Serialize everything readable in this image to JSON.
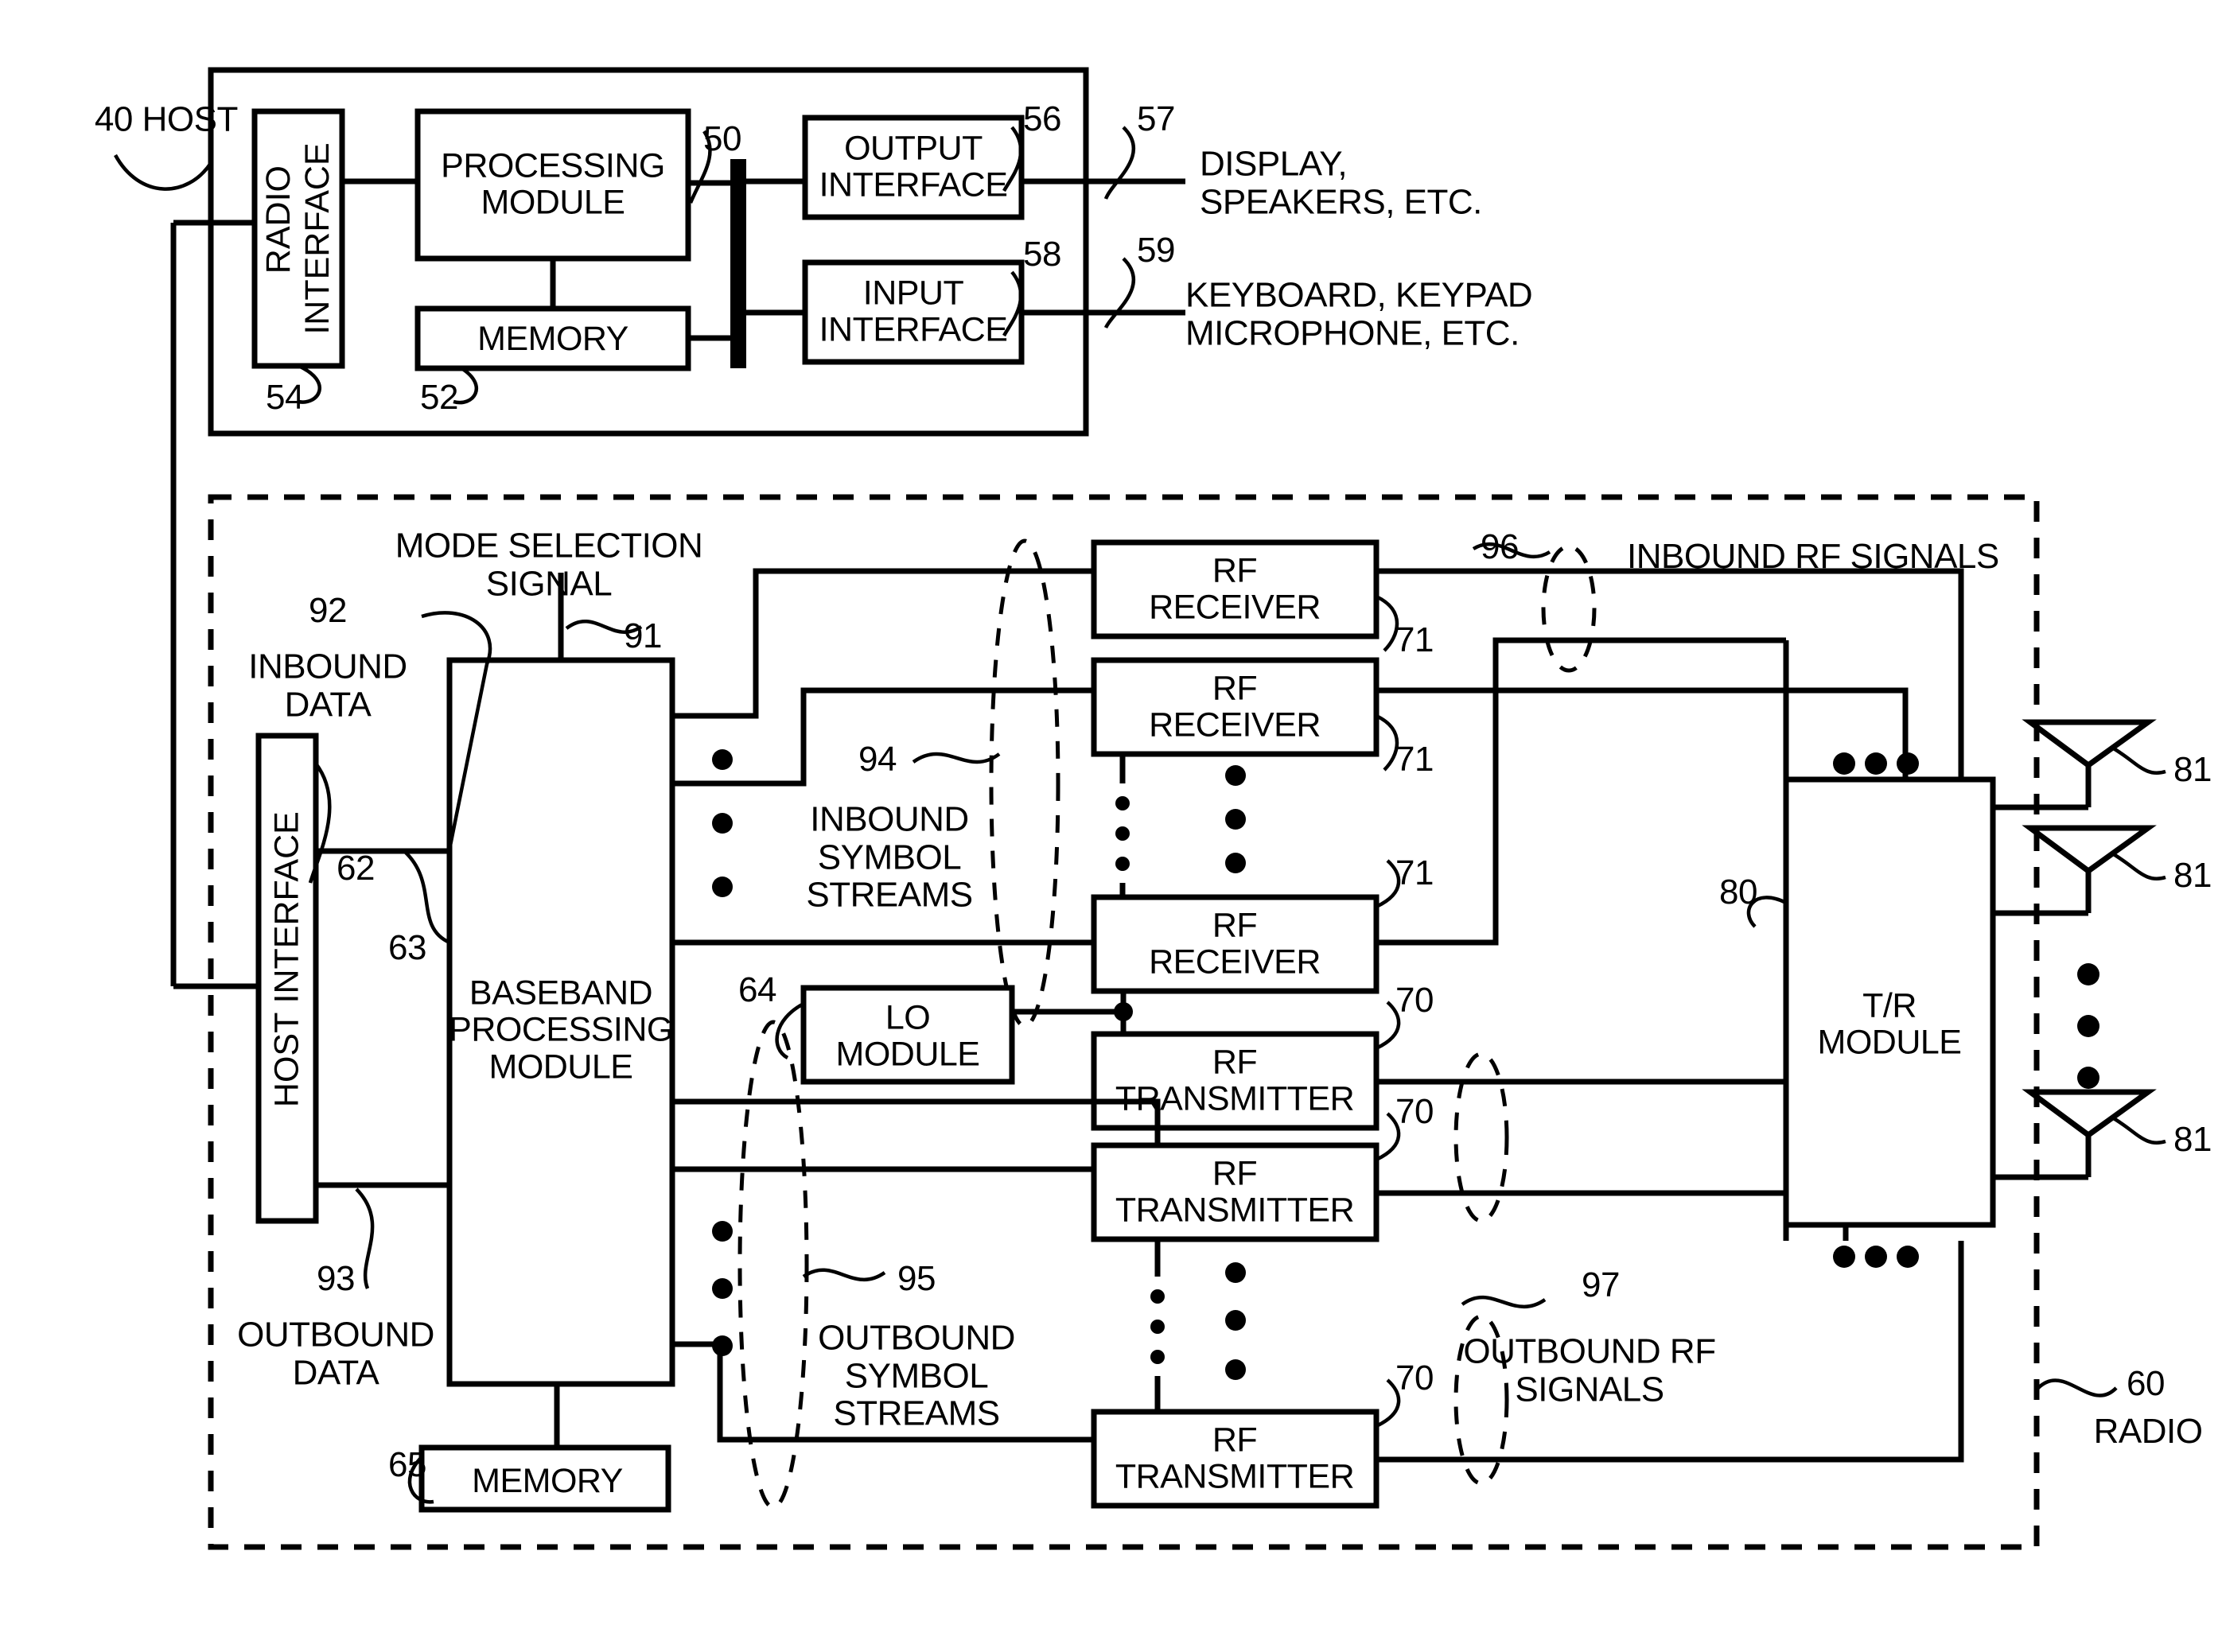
{
  "figure": {
    "type": "patent-block-diagram",
    "title": "Wireless communication device block diagram"
  },
  "host": {
    "ref": "40",
    "label": "HOST",
    "bus_ref": "50",
    "radio_interface": {
      "label": "RADIO\nINTERFACE",
      "ref": "54"
    },
    "processing_module": {
      "label": "PROCESSING\nMODULE",
      "ref": ""
    },
    "memory": {
      "label": "MEMORY",
      "ref": "52"
    },
    "output_interface": {
      "label": "OUTPUT\nINTERFACE",
      "ref": "56"
    },
    "input_interface": {
      "label": "INPUT\nINTERFACE",
      "ref": "58"
    },
    "output_devices": {
      "ref": "57",
      "label": "DISPLAY,\nSPEAKERS, ETC."
    },
    "input_devices": {
      "ref": "59",
      "label": "KEYBOARD, KEYPAD\nMICROPHONE, ETC."
    }
  },
  "radio": {
    "ref": "60",
    "label": "RADIO",
    "host_interface": {
      "label": "HOST INTERFACE",
      "ref": "62"
    },
    "baseband": {
      "label": "BASEBAND\nPROCESSING\nMODULE",
      "ref": "63"
    },
    "memory": {
      "label": "MEMORY",
      "ref": "65"
    },
    "lo_module": {
      "label": "LO\nMODULE",
      "ref": "64"
    },
    "tr_module": {
      "label": "T/R\nMODULE",
      "ref": "80"
    },
    "mode_selection_signal": {
      "label": "MODE SELECTION\nSIGNAL",
      "ref": "91"
    },
    "inbound_data": {
      "ref": "92",
      "label": "INBOUND\nDATA"
    },
    "outbound_data": {
      "ref": "93",
      "label": "OUTBOUND\nDATA"
    },
    "inbound_symbol_streams": {
      "ref": "94",
      "label": "INBOUND\nSYMBOL\nSTREAMS"
    },
    "outbound_symbol_streams": {
      "ref": "95",
      "label": "OUTBOUND\nSYMBOL\nSTREAMS"
    },
    "inbound_rf_signals": {
      "ref": "96",
      "label": "INBOUND RF SIGNALS"
    },
    "outbound_rf_signals": {
      "ref": "97",
      "label": "OUTBOUND RF\nSIGNALS"
    },
    "receivers": [
      {
        "label": "RF\nRECEIVER",
        "ref": "71"
      },
      {
        "label": "RF\nRECEIVER",
        "ref": "71"
      },
      {
        "label": "RF\nRECEIVER",
        "ref": "71"
      }
    ],
    "transmitters": [
      {
        "label": "RF\nTRANSMITTER",
        "ref": "70"
      },
      {
        "label": "RF\nTRANSMITTER",
        "ref": "70"
      },
      {
        "label": "RF\nTRANSMITTER",
        "ref": "70"
      }
    ],
    "antennas": [
      {
        "ref": "81"
      },
      {
        "ref": "81"
      },
      {
        "ref": "81"
      }
    ]
  }
}
